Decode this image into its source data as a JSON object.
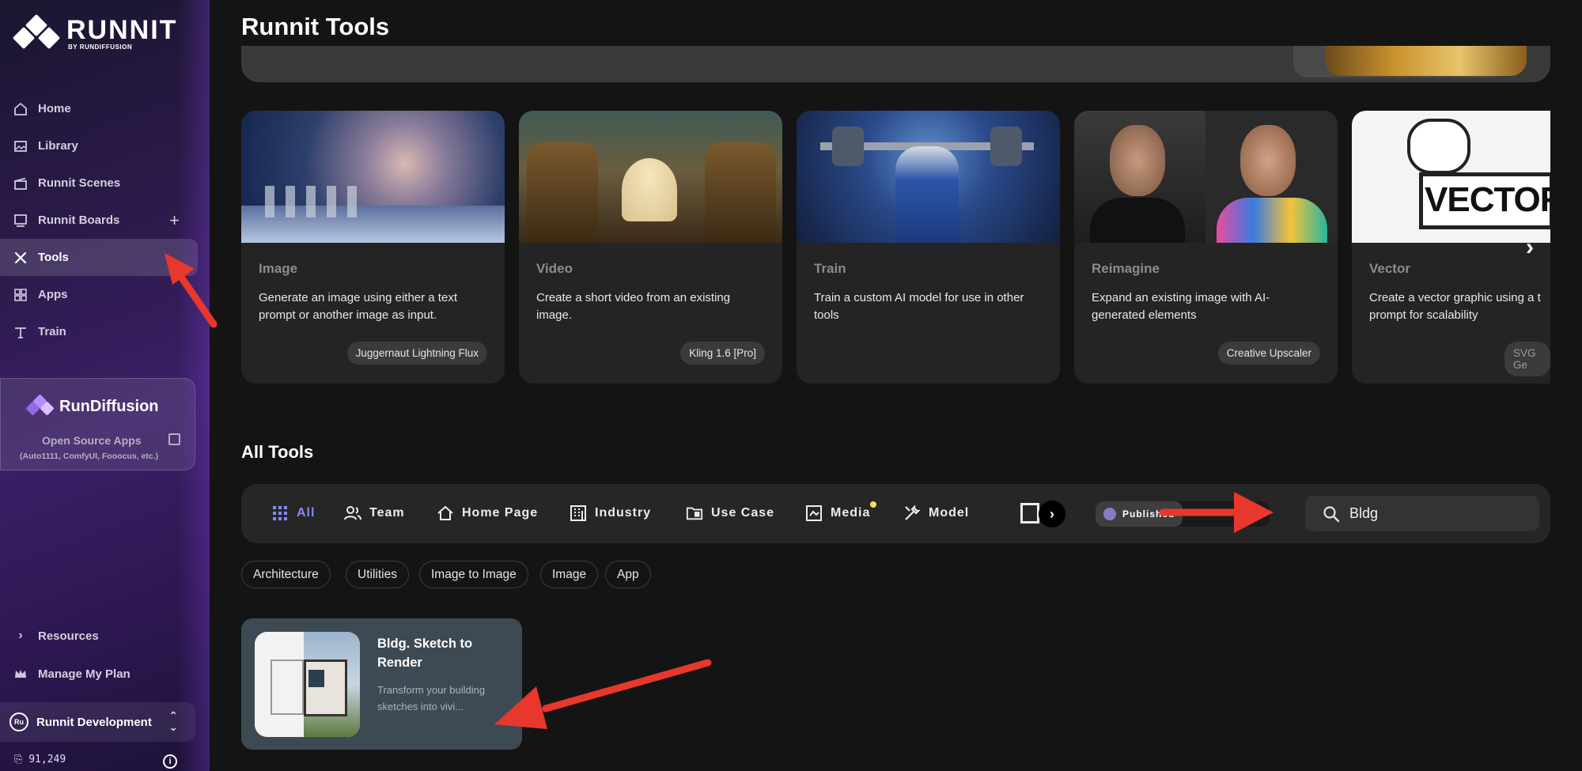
{
  "brand": {
    "name": "RUNNIT",
    "sub": "BY RUNDIFFUSION"
  },
  "nav": [
    {
      "label": "Home",
      "icon": "home-icon"
    },
    {
      "label": "Library",
      "icon": "image-icon"
    },
    {
      "label": "Runnit Scenes",
      "icon": "clapperboard-icon"
    },
    {
      "label": "Runnit Boards",
      "icon": "board-icon"
    },
    {
      "label": "Tools",
      "icon": "tools-icon"
    },
    {
      "label": "Apps",
      "icon": "grid-icon"
    },
    {
      "label": "Train",
      "icon": "dumbbell-icon"
    }
  ],
  "nav_plus": "+",
  "rundiffusion": {
    "title": "RunDiffusion",
    "open": "Open Source Apps",
    "sub": "(Auto1111, ComfyUI, Fooocus, etc.)"
  },
  "bottom_nav": [
    {
      "label": "Resources",
      "icon": "chevron-right-icon"
    },
    {
      "label": "Manage My Plan",
      "icon": "crown-icon"
    }
  ],
  "workspace": {
    "badge": "Ru",
    "name": "Runnit Development"
  },
  "credits": "91,249",
  "page_title": "Runnit Tools",
  "tool_cards": [
    {
      "category": "Image",
      "description": "Generate an image using either a text prompt or another image as input.",
      "tag": "Juggernaut Lightning Flux"
    },
    {
      "category": "Video",
      "description": "Create a short video from an existing image.",
      "tag": "Kling 1.6 [Pro]"
    },
    {
      "category": "Train",
      "description": "Train a custom AI model for use in other tools",
      "tag": ""
    },
    {
      "category": "Reimagine",
      "description": "Expand an existing image with AI-generated elements",
      "tag": "Creative Upscaler"
    },
    {
      "category": "Vector",
      "description": "Create a vector graphic using a t prompt for scalability",
      "tag": "SVG Ge",
      "image_text": "VECTOR"
    }
  ],
  "all_tools_title": "All Tools",
  "filters": [
    {
      "label": "All",
      "icon": "grid-dots-icon"
    },
    {
      "label": "Team",
      "icon": "team-icon"
    },
    {
      "label": "Home Page",
      "icon": "house-icon"
    },
    {
      "label": "Industry",
      "icon": "building-icon"
    },
    {
      "label": "Use Case",
      "icon": "folder-icon"
    },
    {
      "label": "Media",
      "icon": "media-icon"
    },
    {
      "label": "Model",
      "icon": "wrench-icon"
    }
  ],
  "published_label": "Published",
  "search": {
    "value": "Bldg"
  },
  "tags": [
    "Architecture",
    "Utilities",
    "Image to Image",
    "Image",
    "App"
  ],
  "result": {
    "title": "Bldg. Sketch to Render",
    "description": "Transform your building sketches into vivi..."
  },
  "colors": {
    "accent": "#7f8cff",
    "annotation": "#e8372c"
  }
}
